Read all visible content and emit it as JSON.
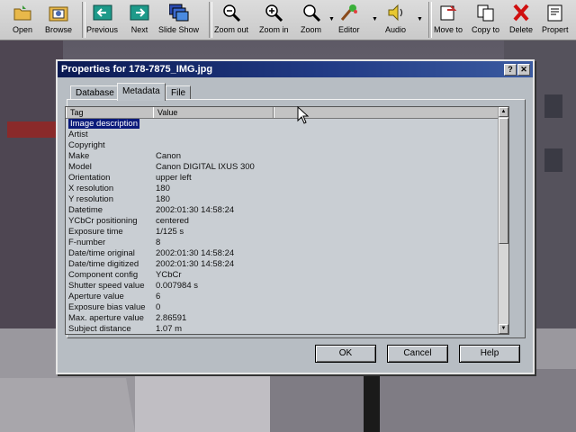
{
  "toolbar": {
    "items": [
      {
        "label": "Open",
        "icon": "open-folder-icon"
      },
      {
        "label": "Browse",
        "icon": "browse-icon"
      },
      {
        "label": "Previous",
        "icon": "previous-icon"
      },
      {
        "label": "Next",
        "icon": "next-icon"
      },
      {
        "label": "Slide Show",
        "icon": "slideshow-icon"
      },
      {
        "label": "Zoom out",
        "icon": "zoom-out-icon"
      },
      {
        "label": "Zoom in",
        "icon": "zoom-in-icon"
      },
      {
        "label": "Zoom",
        "icon": "zoom-icon"
      },
      {
        "label": "Editor",
        "icon": "editor-icon"
      },
      {
        "label": "Audio",
        "icon": "audio-icon"
      },
      {
        "label": "Move to",
        "icon": "move-to-icon"
      },
      {
        "label": "Copy to",
        "icon": "copy-to-icon"
      },
      {
        "label": "Delete",
        "icon": "delete-icon"
      },
      {
        "label": "Propert",
        "icon": "properties-icon"
      }
    ]
  },
  "dialog": {
    "title": "Properties for 178-7875_IMG.jpg",
    "help_glyph": "?",
    "close_glyph": "✕",
    "tabs": [
      {
        "label": "Database",
        "active": false
      },
      {
        "label": "Metadata",
        "active": true
      },
      {
        "label": "File",
        "active": false
      }
    ],
    "columns": [
      "Tag",
      "Value"
    ],
    "rows": [
      {
        "tag": "Image description",
        "value": ""
      },
      {
        "tag": "Artist",
        "value": ""
      },
      {
        "tag": "Copyright",
        "value": ""
      },
      {
        "tag": "Make",
        "value": "Canon"
      },
      {
        "tag": "Model",
        "value": "Canon DIGITAL IXUS 300"
      },
      {
        "tag": "Orientation",
        "value": "upper left"
      },
      {
        "tag": "X resolution",
        "value": "180"
      },
      {
        "tag": "Y resolution",
        "value": "180"
      },
      {
        "tag": "Datetime",
        "value": "2002:01:30 14:58:24"
      },
      {
        "tag": "YCbCr positioning",
        "value": "centered"
      },
      {
        "tag": "Exposure time",
        "value": "1/125 s"
      },
      {
        "tag": "F-number",
        "value": "8"
      },
      {
        "tag": "Date/time original",
        "value": "2002:01:30 14:58:24"
      },
      {
        "tag": "Date/time digitized",
        "value": "2002:01:30 14:58:24"
      },
      {
        "tag": "Component config",
        "value": "YCbCr"
      },
      {
        "tag": "Shutter speed value",
        "value": "0.007984 s"
      },
      {
        "tag": "Aperture value",
        "value": "6"
      },
      {
        "tag": "Exposure bias value",
        "value": "0"
      },
      {
        "tag": "Max. aperture value",
        "value": "2.86591"
      },
      {
        "tag": "Subject distance",
        "value": "1.07 m"
      }
    ],
    "selected_row": 0,
    "buttons": {
      "ok": "OK",
      "cancel": "Cancel",
      "help": "Help"
    }
  },
  "colors": {
    "titlebar": "#0b1a52",
    "selection": "#0a1a7a",
    "dialog_bg": "#b7bdc3"
  }
}
